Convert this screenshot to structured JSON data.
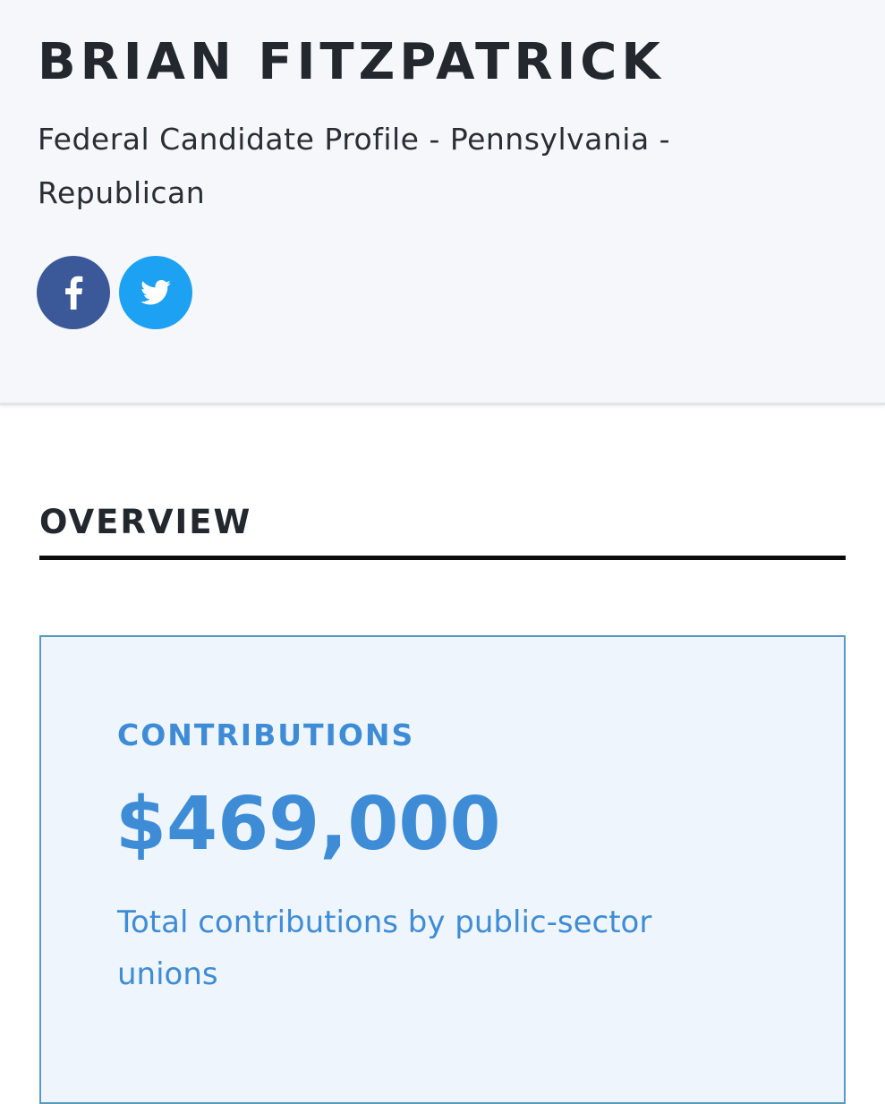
{
  "profile": {
    "name": "BRIAN FITZPATRICK",
    "subtitle": "Federal Candidate Profile - Pennsylvania - Republican"
  },
  "social": {
    "facebook": {
      "icon": "facebook-icon",
      "color": "#3b5998"
    },
    "twitter": {
      "icon": "twitter-icon",
      "color": "#1da1f2"
    }
  },
  "overview": {
    "heading": "OVERVIEW",
    "card": {
      "label": "CONTRIBUTIONS",
      "value": "$469,000",
      "description": "Total contributions by public-sector unions"
    }
  },
  "colors": {
    "accent_blue": "#3f8cd6",
    "card_background": "#eef5fd",
    "card_border": "#5b9ac0",
    "header_background": "#f5f7fa"
  }
}
